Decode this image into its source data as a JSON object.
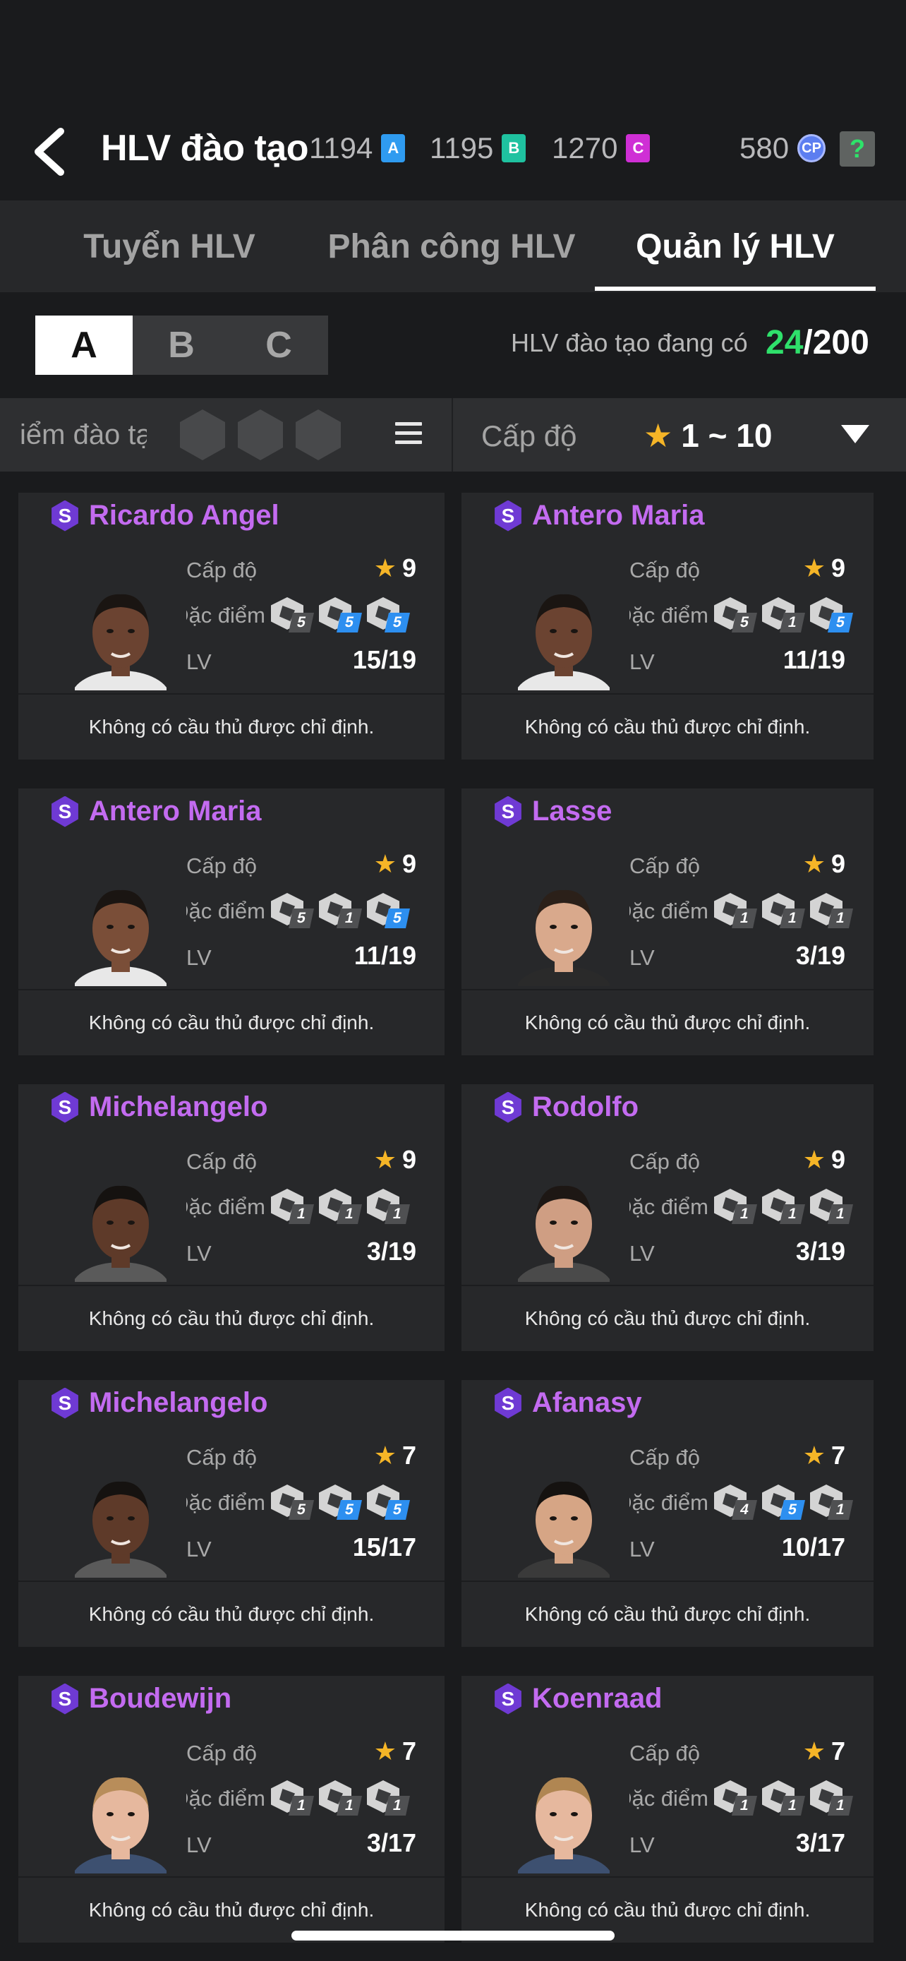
{
  "header": {
    "title": "HLV đào tạo",
    "currencies": [
      {
        "value": "1194",
        "badge": "A",
        "color": "#2f9bf0"
      },
      {
        "value": "1195",
        "badge": "B",
        "color": "#1fc2a0"
      },
      {
        "value": "1270",
        "badge": "C",
        "color": "#cf2fd5"
      }
    ],
    "cp": {
      "value": "580",
      "badge": "CP"
    },
    "help_label": "?"
  },
  "tabs": [
    {
      "label": "Tuyển HLV",
      "active": false
    },
    {
      "label": "Phân công HLV",
      "active": false
    },
    {
      "label": "Quản lý HLV",
      "active": true
    }
  ],
  "subtabs": [
    {
      "label": "A",
      "active": true
    },
    {
      "label": "B",
      "active": false
    },
    {
      "label": "C",
      "active": false
    }
  ],
  "coach_count": {
    "label": "HLV đào tạo đang có",
    "current": "24",
    "max": "/200"
  },
  "filter": {
    "training_points_label": "iểm đào tạ",
    "level_label": "Cấp độ",
    "level_range": "1 ~ 10"
  },
  "card_labels": {
    "level": "Cấp độ",
    "traits": "Đặc điểm",
    "lv": "LV",
    "note": "Không có cầu thủ được chỉ định."
  },
  "coaches": [
    {
      "name": "Ricardo Angel",
      "level": "9",
      "lv": "15/19",
      "traits": [
        {
          "lv": "5",
          "blue": false
        },
        {
          "lv": "5",
          "blue": true
        },
        {
          "lv": "5",
          "blue": true
        }
      ]
    },
    {
      "name": "Antero Maria",
      "level": "9",
      "lv": "11/19",
      "traits": [
        {
          "lv": "5",
          "blue": false
        },
        {
          "lv": "1",
          "blue": false
        },
        {
          "lv": "5",
          "blue": true
        }
      ]
    },
    {
      "name": "Antero Maria",
      "level": "9",
      "lv": "11/19",
      "traits": [
        {
          "lv": "5",
          "blue": false
        },
        {
          "lv": "1",
          "blue": false
        },
        {
          "lv": "5",
          "blue": true
        }
      ]
    },
    {
      "name": "Lasse",
      "level": "9",
      "lv": "3/19",
      "traits": [
        {
          "lv": "1",
          "blue": false
        },
        {
          "lv": "1",
          "blue": false
        },
        {
          "lv": "1",
          "blue": false
        }
      ]
    },
    {
      "name": "Michelangelo",
      "level": "9",
      "lv": "3/19",
      "traits": [
        {
          "lv": "1",
          "blue": false
        },
        {
          "lv": "1",
          "blue": false
        },
        {
          "lv": "1",
          "blue": false
        }
      ]
    },
    {
      "name": "Rodolfo",
      "level": "9",
      "lv": "3/19",
      "traits": [
        {
          "lv": "1",
          "blue": false
        },
        {
          "lv": "1",
          "blue": false
        },
        {
          "lv": "1",
          "blue": false
        }
      ]
    },
    {
      "name": "Michelangelo",
      "level": "7",
      "lv": "15/17",
      "traits": [
        {
          "lv": "5",
          "blue": false
        },
        {
          "lv": "5",
          "blue": true
        },
        {
          "lv": "5",
          "blue": true
        }
      ]
    },
    {
      "name": "Afanasy",
      "level": "7",
      "lv": "10/17",
      "traits": [
        {
          "lv": "4",
          "blue": false
        },
        {
          "lv": "5",
          "blue": true
        },
        {
          "lv": "1",
          "blue": false
        }
      ]
    },
    {
      "name": "Boudewijn",
      "level": "7",
      "lv": "3/17",
      "traits": [
        {
          "lv": "1",
          "blue": false
        },
        {
          "lv": "1",
          "blue": false
        },
        {
          "lv": "1",
          "blue": false
        }
      ]
    },
    {
      "name": "Koenraad",
      "level": "7",
      "lv": "3/17",
      "traits": [
        {
          "lv": "1",
          "blue": false
        },
        {
          "lv": "1",
          "blue": false
        },
        {
          "lv": "1",
          "blue": false
        }
      ]
    }
  ],
  "portrait_tones": [
    {
      "skin": "#6b4331",
      "hair": "#1a1512",
      "shirt": "#e8e8e8"
    },
    {
      "skin": "#6b4331",
      "hair": "#1a1512",
      "shirt": "#e8e8e8"
    },
    {
      "skin": "#7a4e38",
      "hair": "#1a1512",
      "shirt": "#e8e8e8"
    },
    {
      "skin": "#d9a98c",
      "hair": "#2b2019",
      "shirt": "#2a2a2a"
    },
    {
      "skin": "#5e3a29",
      "hair": "#151210",
      "shirt": "#5a5a5a"
    },
    {
      "skin": "#cf9e83",
      "hair": "#1d1714",
      "shirt": "#4a4a4a"
    },
    {
      "skin": "#5e3a29",
      "hair": "#151210",
      "shirt": "#5a5a5a"
    },
    {
      "skin": "#d6a585",
      "hair": "#151210",
      "shirt": "#3a3a3a"
    },
    {
      "skin": "#e6b89e",
      "hair": "#b88d5a",
      "shirt": "#3d5070"
    },
    {
      "skin": "#e6b89e",
      "hair": "#b08652",
      "shirt": "#3d5070"
    }
  ]
}
